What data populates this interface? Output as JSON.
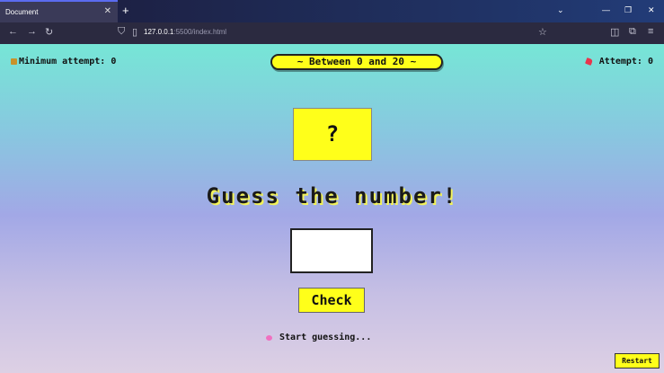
{
  "browser": {
    "tab_title": "Document",
    "tab_close": "✕",
    "new_tab": "+",
    "url_host": "127.0.0.1",
    "url_rest": ":5500/index.html",
    "win_min": "—",
    "win_restore": "❐",
    "win_close": "✕",
    "menu_glyph": "⌄"
  },
  "game": {
    "min_attempt_label": "Minimum attempt: 0",
    "range_label": "~ Between 0 and 20 ~",
    "attempt_label": "Attempt: 0",
    "secret": "?",
    "title": "Guess the number!",
    "input_value": "",
    "check_label": "Check",
    "message": "Start guessing...",
    "restart_label": "Restart"
  },
  "colors": {
    "accent_yellow": "#ffff1a",
    "bg_top": "#76e6d6",
    "bg_mid": "#a2a8e6",
    "bg_bottom": "#ddd0e4"
  }
}
